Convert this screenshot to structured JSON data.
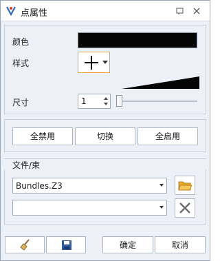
{
  "window": {
    "title": "点属性"
  },
  "color": {
    "label": "颜色",
    "value": "#050505"
  },
  "style": {
    "label": "样式",
    "symbol": "plus-icon"
  },
  "size": {
    "label": "尺寸",
    "value": "1"
  },
  "actions": {
    "disable_all": "全禁用",
    "toggle": "切换",
    "enable_all": "全启用"
  },
  "file_group": {
    "label": "文件/束",
    "file_value": "Bundles.Z3",
    "bundle_value": ""
  },
  "footer": {
    "ok": "确定",
    "cancel": "取消"
  }
}
